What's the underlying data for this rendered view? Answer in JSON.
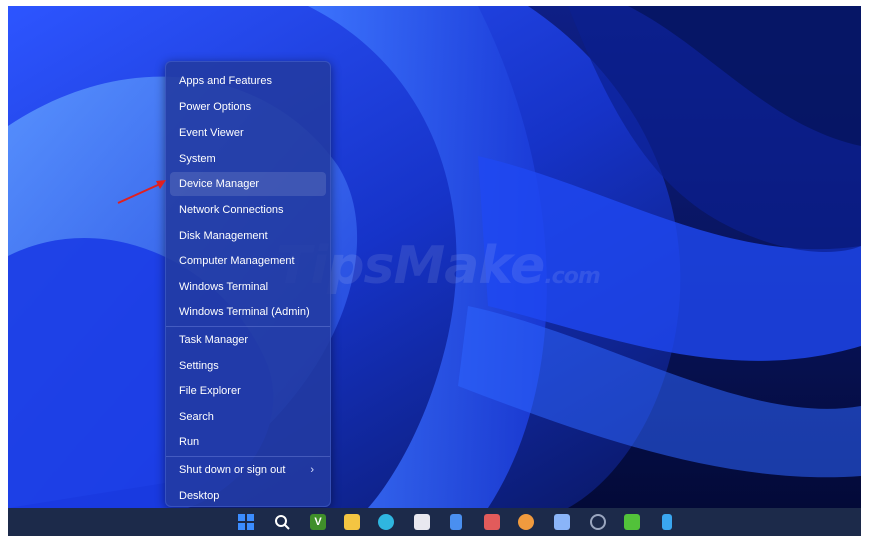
{
  "context_menu": {
    "items": [
      {
        "label": "Apps and Features"
      },
      {
        "label": "Power Options"
      },
      {
        "label": "Event Viewer"
      },
      {
        "label": "System"
      },
      {
        "label": "Device Manager"
      },
      {
        "label": "Network Connections"
      },
      {
        "label": "Disk Management"
      },
      {
        "label": "Computer Management"
      },
      {
        "label": "Windows Terminal"
      },
      {
        "label": "Windows Terminal (Admin)"
      },
      {
        "label": "Task Manager"
      },
      {
        "label": "Settings"
      },
      {
        "label": "File Explorer"
      },
      {
        "label": "Search"
      },
      {
        "label": "Run"
      },
      {
        "label": "Shut down or sign out"
      },
      {
        "label": "Desktop"
      }
    ],
    "highlighted": "Device Manager"
  },
  "watermark": {
    "main": "TipsMake",
    "suffix": ".com"
  },
  "taskbar": {
    "icons": [
      {
        "name": "start-icon",
        "color": "#3b8cff"
      },
      {
        "name": "search-icon",
        "color": "#ffffff"
      },
      {
        "name": "vim-icon",
        "color": "#3f8f2a"
      },
      {
        "name": "file-explorer-icon",
        "color": "#f4c542"
      },
      {
        "name": "edge-icon",
        "color": "#2fb6e0"
      },
      {
        "name": "store-icon",
        "color": "#e8e8f0"
      },
      {
        "name": "notepad-icon",
        "color": "#4a8ff0"
      },
      {
        "name": "snipping-tool-icon",
        "color": "#e25b5b"
      },
      {
        "name": "paint-icon",
        "color": "#f09a3e"
      },
      {
        "name": "remote-desktop-icon",
        "color": "#8ab4f8"
      },
      {
        "name": "camera-icon",
        "color": "#9aa6bf"
      },
      {
        "name": "green-app-icon",
        "color": "#52c23a"
      },
      {
        "name": "phone-link-icon",
        "color": "#3aa6f0"
      }
    ]
  },
  "colors": {
    "menu_bg": "#223aa0",
    "taskbar_bg": "#1c2a4a",
    "annotation_arrow": "#e02020"
  }
}
